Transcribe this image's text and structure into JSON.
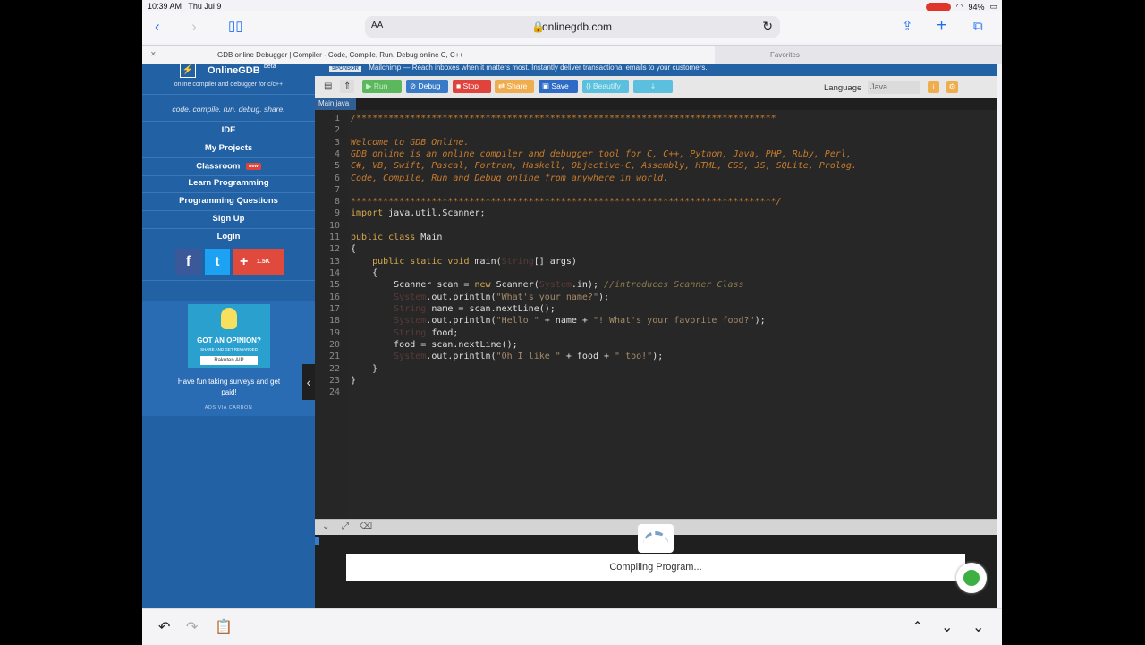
{
  "status": {
    "time": "10:39 AM",
    "date": "Thu Jul 9",
    "battery": "94%"
  },
  "safari": {
    "reader": "AA",
    "url": "onlinegdb.com",
    "tab_title": "GDB online Debugger | Compiler - Code, Compile, Run, Debug online C, C++",
    "favorites": "Favorites"
  },
  "brand": {
    "name": "OnlineGDB",
    "beta": "beta",
    "tagline": "online compiler and debugger for c/c++",
    "motto": "code. compile. run. debug. share."
  },
  "sponsor": {
    "badge": "SPONSOR",
    "text": "Mailchimp — Reach inboxes when it matters most. Instantly deliver transactional emails to your customers."
  },
  "nav": [
    {
      "label": "IDE"
    },
    {
      "label": "My Projects"
    },
    {
      "label": "Classroom",
      "badge": "new"
    },
    {
      "label": "Learn Programming"
    },
    {
      "label": "Programming Questions"
    },
    {
      "label": "Sign Up"
    },
    {
      "label": "Login"
    }
  ],
  "social": {
    "facebook": "f",
    "twitter": "t",
    "share_count": "1.5K"
  },
  "ad": {
    "headline": "GOT AN OPINION?",
    "sub": "SHARE AND GET REWARDED",
    "brand": "Rakuten AIP",
    "text": "Have fun taking surveys and get paid!",
    "via": "ADS VIA CARBON"
  },
  "toolbar": {
    "run": "Run",
    "debug": "Debug",
    "stop": "Stop",
    "share": "Share",
    "save": "Save",
    "beautify": "{} Beautify",
    "language_label": "Language",
    "language_value": "Java"
  },
  "file_tab": "Main.java",
  "code_lines": [
    "1",
    "2",
    "3",
    "4",
    "5",
    "6",
    "7",
    "8",
    "9",
    "10",
    "11",
    "12",
    "13",
    "14",
    "15",
    "16",
    "17",
    "18",
    "19",
    "20",
    "21",
    "22",
    "23",
    "24"
  ],
  "console": {
    "status": "Compiling Program..."
  },
  "colors": {
    "sidebar": "#2361a5",
    "editor_bg": "#272727",
    "run": "#5cb85c",
    "debug": "#3a7bc8",
    "stop": "#e0433b",
    "share": "#f0ad4e",
    "save": "#2e6bc6",
    "beautify": "#5bc0de"
  }
}
